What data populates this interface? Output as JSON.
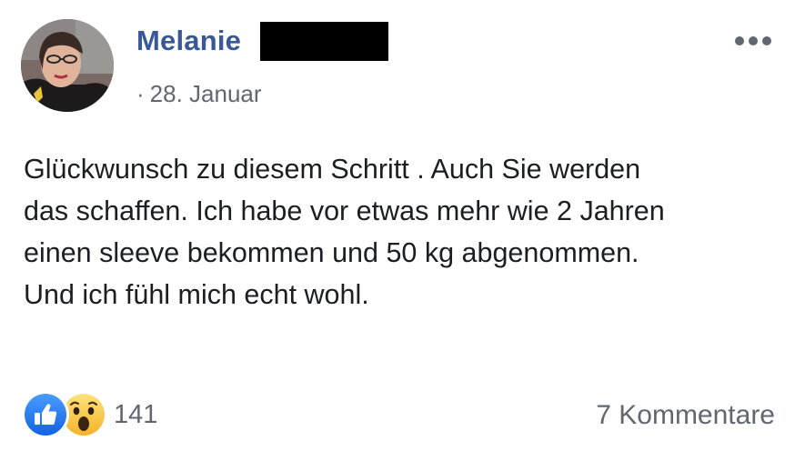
{
  "post": {
    "author": "Melanie",
    "separator": "·",
    "date": "28. Januar",
    "more_icon": "more-horizontal-icon",
    "body_lines": [
      "Glückwunsch zu diesem Schritt . Auch Sie werden",
      "das schaffen. Ich habe vor etwas mehr wie 2 Jahren",
      "einen sleeve bekommen und 50 kg abgenommen.",
      "Und ich fühl mich echt wohl."
    ]
  },
  "reactions": {
    "icons": [
      "like-icon",
      "wow-icon"
    ],
    "count": "141"
  },
  "comments": {
    "label": "7 Kommentare"
  },
  "colors": {
    "author": "#385898",
    "meta": "#616770",
    "text": "#1c1e21",
    "like": "#1877f2",
    "wow": "#f7c844"
  }
}
